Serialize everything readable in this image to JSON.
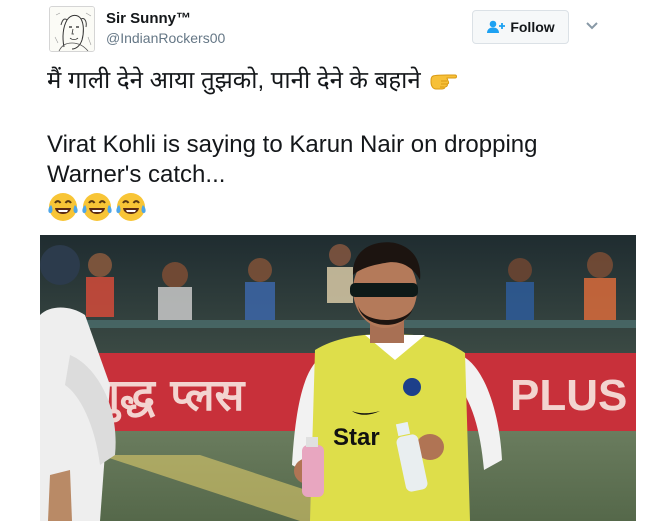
{
  "author": {
    "name": "Sir Sunny™",
    "handle": "@IndianRockers00"
  },
  "follow_button": {
    "label": "Follow",
    "icon": "add-person-icon"
  },
  "menu": {
    "icon": "chevron-down-icon"
  },
  "tweet": {
    "line1": "मैं गाली देने आया तुझको, पानी देने के बहाने",
    "line2": "Virat Kohli is saying to Karun Nair on dropping",
    "line3": "Warner's catch...",
    "emojis": [
      "face-with-tears-of-joy",
      "face-with-tears-of-joy",
      "face-with-tears-of-joy"
    ],
    "pointing_emoji": "backhand-index-pointing-left"
  },
  "photo": {
    "banner_left": "शुद्ध प्लस",
    "banner_right": "PLUS",
    "bib_sponsor": "Star",
    "colors": {
      "bib": "#dede4a",
      "banner": "#c8303a",
      "stand": "#2e3c3a"
    }
  },
  "colors": {
    "text": "#14171a",
    "secondary": "#657786",
    "accent": "#1da1f2"
  }
}
